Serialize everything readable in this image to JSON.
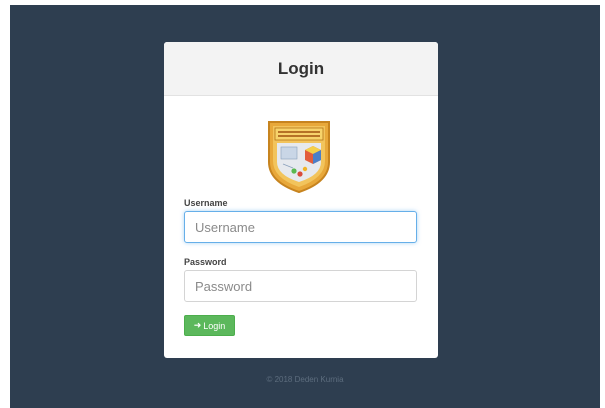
{
  "login": {
    "title": "Login",
    "username_label": "Username",
    "username_placeholder": "Username",
    "username_value": "",
    "password_label": "Password",
    "password_placeholder": "Password",
    "password_value": "",
    "button_label": "Login",
    "button_icon": "sign-in-icon"
  },
  "logo": {
    "name": "school-crest-logo"
  },
  "footer": {
    "copyright": "© 2018 Deden Kurnia"
  },
  "colors": {
    "background": "#2e3e50",
    "panel": "#ffffff",
    "header": "#f3f3f3",
    "button": "#5cb85c",
    "focus": "#66afe9",
    "logo_gold": "#e8a83a"
  }
}
